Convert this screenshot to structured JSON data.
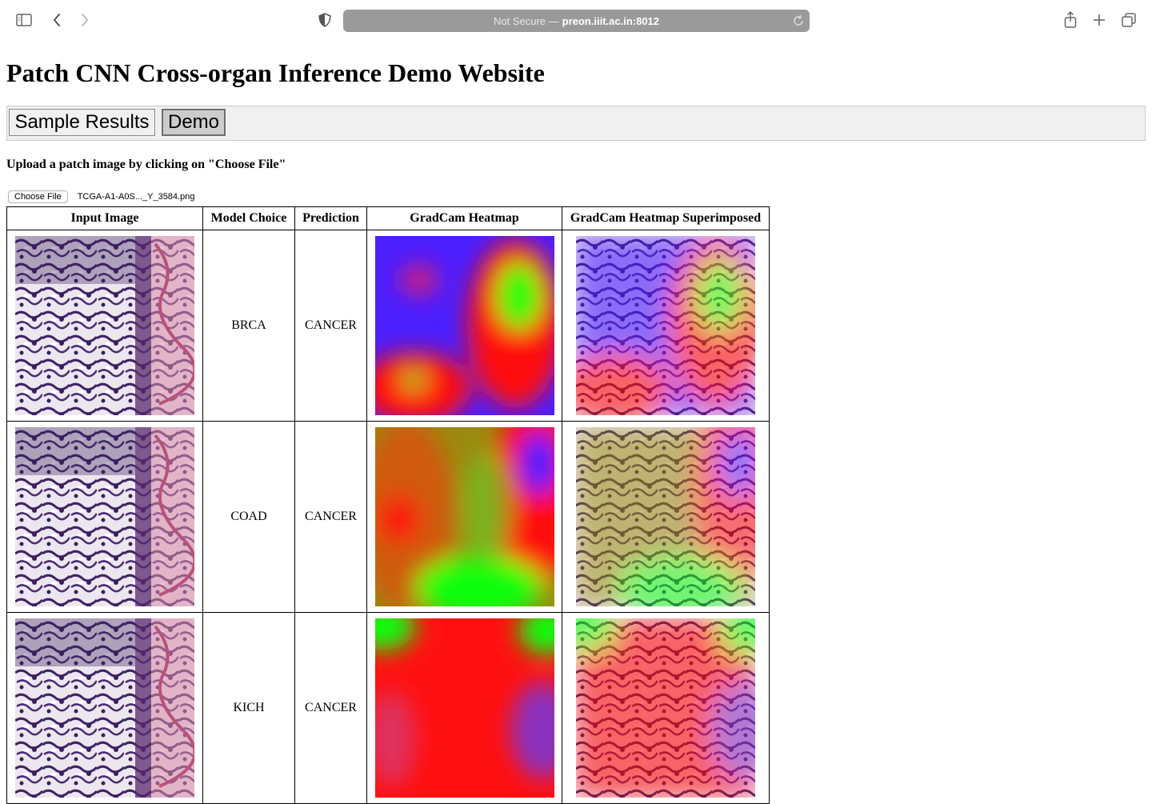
{
  "browser": {
    "url_prefix": "Not Secure —",
    "url_host": "preon.iiit.ac.in:8012"
  },
  "page": {
    "title": "Patch CNN Cross-organ Inference Demo Website",
    "tabs": [
      {
        "label": "Sample Results",
        "active": false
      },
      {
        "label": "Demo",
        "active": true
      }
    ],
    "instruction": "Upload a patch image by clicking on \"Choose File\"",
    "file_input": {
      "button_label": "Choose File",
      "file_name": "TCGA-A1-A0S..._Y_3584.png"
    }
  },
  "table": {
    "headers": [
      "Input Image",
      "Model Choice",
      "Prediction",
      "GradCam Heatmap",
      "GradCam Heatmap Superimposed"
    ],
    "rows": [
      {
        "model": "BRCA",
        "prediction": "CANCER"
      },
      {
        "model": "COAD",
        "prediction": "CANCER"
      },
      {
        "model": "KICH",
        "prediction": "CANCER"
      }
    ]
  },
  "colors": {
    "tissue_purple": "#3a1f5c",
    "tissue_pink": "#d98aa8",
    "heat_blue": "#4b1fff",
    "heat_red": "#ff1010",
    "heat_green": "#10ff10"
  }
}
